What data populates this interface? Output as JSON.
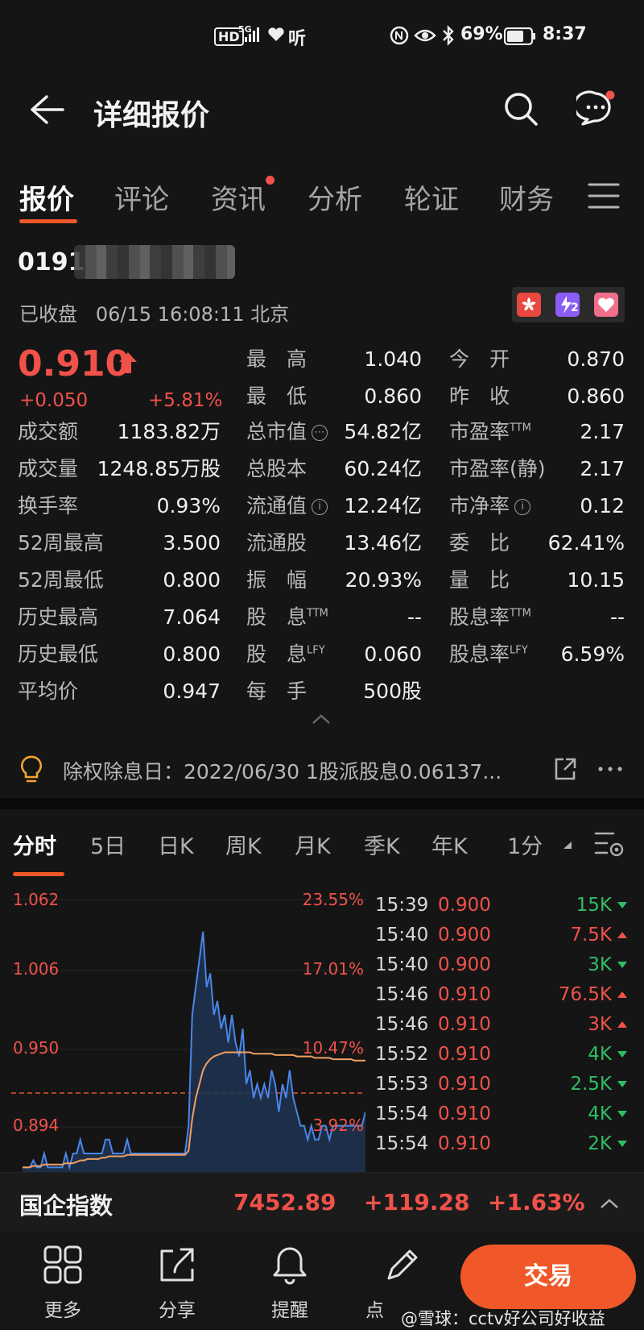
{
  "status_bar": {
    "hd": "HD",
    "network": "5G",
    "listen": "听",
    "battery": "69%",
    "time": "8:37"
  },
  "header": {
    "title": "详细报价"
  },
  "tabs": [
    "报价",
    "评论",
    "资讯",
    "分析",
    "轮证",
    "财务"
  ],
  "stock": {
    "code": "0191",
    "status": "已收盘",
    "datetime": "06/15 16:08:11 北京",
    "flag2": "2",
    "price": "0.910",
    "change": "+0.050",
    "change_pct": "+5.81%"
  },
  "quote_left": [
    {
      "label": "成交额",
      "value": "1183.82万"
    },
    {
      "label": "成交量",
      "value": "1248.85万股"
    },
    {
      "label": "换手率",
      "value": "0.93%"
    },
    {
      "label": "52周最高",
      "value": "3.500"
    },
    {
      "label": "52周最低",
      "value": "0.800"
    },
    {
      "label": "历史最高",
      "value": "7.064"
    },
    {
      "label": "历史最低",
      "value": "0.800"
    },
    {
      "label": "平均价",
      "value": "0.947"
    }
  ],
  "quote_mid": [
    {
      "label": "最　高",
      "value": "1.040"
    },
    {
      "label": "最　低",
      "value": "0.860"
    },
    {
      "label": "总市值",
      "value": "54.82亿"
    },
    {
      "label": "总股本",
      "value": "60.24亿"
    },
    {
      "label": "流通值",
      "value": "12.24亿"
    },
    {
      "label": "流通股",
      "value": "13.46亿"
    },
    {
      "label": "振　幅",
      "value": "20.93%"
    },
    {
      "label": "股　息",
      "sup": "TTM",
      "value": "--"
    },
    {
      "label": "股　息",
      "sup": "LFY",
      "value": "0.060"
    },
    {
      "label": "每　手",
      "value": "500股"
    }
  ],
  "quote_right": [
    {
      "label": "今　开",
      "value": "0.870"
    },
    {
      "label": "昨　收",
      "value": "0.860"
    },
    {
      "label": "市盈率",
      "sup": "TTM",
      "value": "2.17"
    },
    {
      "label": "市盈率(静)",
      "value": "2.17"
    },
    {
      "label": "市净率",
      "value": "0.12"
    },
    {
      "label": "委　比",
      "value": "62.41%"
    },
    {
      "label": "量　比",
      "value": "10.15"
    },
    {
      "label": "股息率",
      "sup": "TTM",
      "value": "--"
    },
    {
      "label": "股息率",
      "sup": "LFY",
      "value": "6.59%"
    }
  ],
  "exdiv": {
    "text": "除权除息日：2022/06/30  1股派股息0.06137..."
  },
  "chart_tabs": [
    "分时",
    "5日",
    "日K",
    "周K",
    "月K",
    "季K",
    "年K",
    "1分"
  ],
  "chart": {
    "y_labels": [
      "1.062",
      "1.006",
      "0.950",
      "0.894"
    ],
    "pct_labels": [
      "23.55%",
      "17.01%",
      "10.47%",
      "3.92%"
    ]
  },
  "chart_data": {
    "type": "line",
    "title": "",
    "xlabel": "",
    "ylabel": "",
    "ylim": [
      0.86,
      1.062
    ],
    "prev_close": 0.86,
    "series": [
      {
        "values": [
          0.87,
          0.87,
          0.87,
          0.875,
          0.87,
          0.87,
          0.88,
          0.87,
          0.87,
          0.87,
          0.87,
          0.87,
          0.88,
          0.87,
          0.88,
          0.88,
          0.89,
          0.88,
          0.88,
          0.88,
          0.88,
          0.88,
          0.88,
          0.89,
          0.89,
          0.88,
          0.88,
          0.88,
          0.88,
          0.89,
          0.88,
          0.88,
          0.88,
          0.88,
          0.88,
          0.88,
          0.88,
          0.88,
          0.88,
          0.88,
          0.88,
          0.88,
          0.88,
          0.88,
          0.88,
          0.88,
          0.9,
          0.98,
          1.0,
          1.02,
          1.04,
          1.0,
          1.01,
          0.98,
          0.99,
          0.97,
          0.98,
          0.96,
          0.98,
          0.96,
          0.95,
          0.97,
          0.93,
          0.94,
          0.92,
          0.93,
          0.92,
          0.93,
          0.92,
          0.94,
          0.93,
          0.91,
          0.93,
          0.92,
          0.94,
          0.92,
          0.91,
          0.9,
          0.9,
          0.89,
          0.9,
          0.89,
          0.89,
          0.9,
          0.9,
          0.89,
          0.9,
          0.9,
          0.9,
          0.9,
          0.9,
          0.9,
          0.9,
          0.9,
          0.9,
          0.91
        ]
      },
      {
        "values": [
          0.87,
          0.87,
          0.87,
          0.871,
          0.871,
          0.871,
          0.872,
          0.872,
          0.872,
          0.872,
          0.872,
          0.872,
          0.873,
          0.873,
          0.873,
          0.874,
          0.875,
          0.875,
          0.876,
          0.876,
          0.876,
          0.876,
          0.877,
          0.877,
          0.878,
          0.878,
          0.878,
          0.878,
          0.878,
          0.879,
          0.879,
          0.879,
          0.879,
          0.879,
          0.879,
          0.879,
          0.879,
          0.879,
          0.879,
          0.879,
          0.879,
          0.879,
          0.879,
          0.879,
          0.879,
          0.879,
          0.882,
          0.905,
          0.92,
          0.93,
          0.94,
          0.945,
          0.948,
          0.95,
          0.951,
          0.952,
          0.953,
          0.953,
          0.953,
          0.953,
          0.953,
          0.953,
          0.953,
          0.953,
          0.952,
          0.952,
          0.952,
          0.952,
          0.952,
          0.952,
          0.951,
          0.951,
          0.951,
          0.951,
          0.951,
          0.951,
          0.95,
          0.95,
          0.95,
          0.95,
          0.95,
          0.949,
          0.949,
          0.949,
          0.949,
          0.949,
          0.948,
          0.948,
          0.948,
          0.948,
          0.948,
          0.948,
          0.947,
          0.947,
          0.947,
          0.947
        ]
      }
    ]
  },
  "ticks": [
    {
      "time": "15:39",
      "price": "0.900",
      "vol": "15K",
      "dir": "down"
    },
    {
      "time": "15:40",
      "price": "0.900",
      "vol": "7.5K",
      "dir": "up"
    },
    {
      "time": "15:40",
      "price": "0.900",
      "vol": "3K",
      "dir": "down"
    },
    {
      "time": "15:46",
      "price": "0.910",
      "vol": "76.5K",
      "dir": "up"
    },
    {
      "time": "15:46",
      "price": "0.910",
      "vol": "3K",
      "dir": "up"
    },
    {
      "time": "15:52",
      "price": "0.910",
      "vol": "4K",
      "dir": "down"
    },
    {
      "time": "15:53",
      "price": "0.910",
      "vol": "2.5K",
      "dir": "down"
    },
    {
      "time": "15:54",
      "price": "0.910",
      "vol": "4K",
      "dir": "down"
    },
    {
      "time": "15:54",
      "price": "0.910",
      "vol": "2K",
      "dir": "down"
    }
  ],
  "index": {
    "name": "国企指数",
    "value": "7452.89",
    "change": "+119.28",
    "pct": "+1.63%"
  },
  "bottom_nav": {
    "more": "更多",
    "share": "分享",
    "alert": "提醒",
    "draw": "点",
    "trade": "交易"
  },
  "watermark": "@雪球：cctv好公司好收益",
  "colors": {
    "up": "#f0524a",
    "down": "#2fbd65",
    "accent": "#f0582a",
    "line": "#4a86e8",
    "avg": "#f0a060"
  }
}
